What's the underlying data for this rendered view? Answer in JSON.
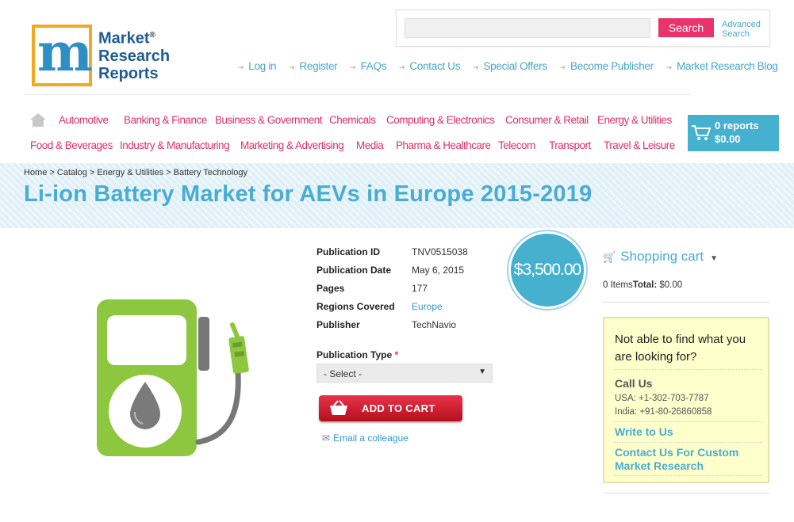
{
  "logo": {
    "line1": "Market",
    "line2": "Research",
    "line3": "Reports",
    "reg": "®",
    "colors": {
      "orange": "#f5a623",
      "blue": "#2e8fc4",
      "green": "#7ab929"
    }
  },
  "search": {
    "placeholder": "",
    "button": "Search",
    "advanced_line1": "Advanced",
    "advanced_line2": "Search"
  },
  "toplinks": [
    "Log in",
    "Register",
    "FAQs",
    "Contact Us",
    "Special Offers",
    "Become Publisher",
    "Market Research Blog"
  ],
  "categories_row1": [
    "Automotive",
    "Banking & Finance",
    "Business & Government",
    "Chemicals",
    "Computing & Electronics",
    "Consumer & Retail",
    "Energy & Utilities"
  ],
  "categories_row2": [
    "Food & Beverages",
    "Industry & Manufacturing",
    "Marketing & Advertising",
    "Media",
    "Pharma & Healthcare",
    "Telecom",
    "Transport",
    "Travel & Leisure"
  ],
  "cart_button": {
    "count": "0 reports",
    "amount": "$0.00"
  },
  "breadcrumb": [
    "Home",
    "Catalog",
    "Energy & Utilities",
    "Battery Technology"
  ],
  "title": "Li-ion Battery Market for AEVs in Europe 2015-2019",
  "details": [
    {
      "label": "Publication ID",
      "value": "TNV0515038"
    },
    {
      "label": "Publication Date",
      "value": "May 6, 2015"
    },
    {
      "label": "Pages",
      "value": "177"
    },
    {
      "label": "Regions Covered",
      "value": "Europe"
    },
    {
      "label": "Publisher",
      "value": "TechNavio"
    }
  ],
  "price": "$3,500.00",
  "publication_type": {
    "label": "Publication Type",
    "required": "*",
    "selected": "- Select -"
  },
  "add_to_cart": "ADD TO CART",
  "email_colleague": "Email a colleague",
  "shopping_cart": {
    "title": "Shopping cart",
    "items": "0 Items",
    "total_label": "Total:",
    "total_value": "$0.00"
  },
  "help_box": {
    "title": "Not able to find what you are looking for?",
    "call_title": "Call Us",
    "usa": "USA: +1-302-703-7787",
    "india": "India: +91-80-26860858",
    "write": "Write to Us",
    "custom": "Contact Us For Custom Market Research"
  },
  "accent_colors": {
    "pink": "#e0306a",
    "teal": "#46b0cf",
    "red": "#c8192a"
  }
}
